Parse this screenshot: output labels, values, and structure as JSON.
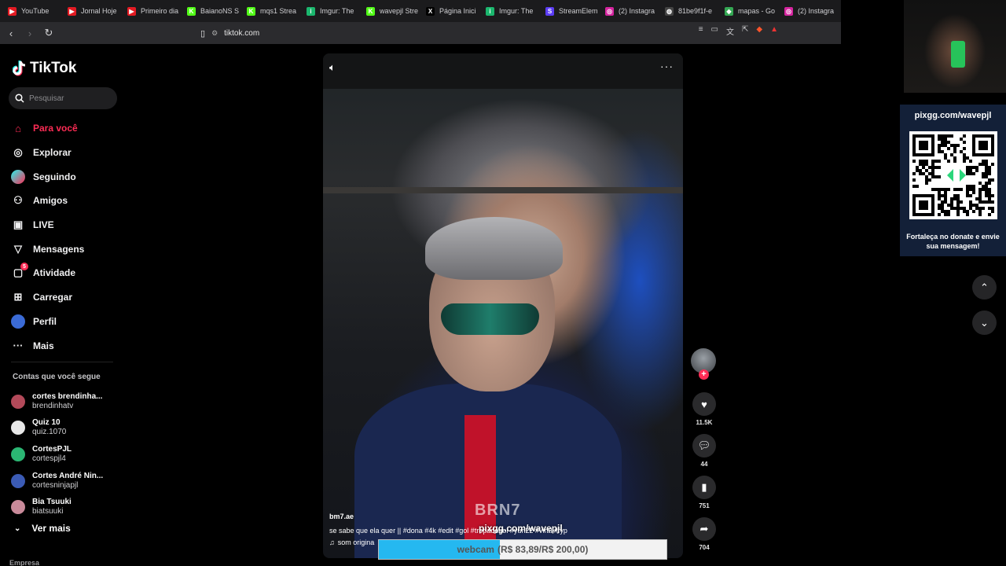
{
  "browser": {
    "tabs": [
      {
        "title": "YouTube",
        "color": "#e31b23",
        "glyph": "▶"
      },
      {
        "title": "Jornal Hoje",
        "color": "#e31b23",
        "glyph": "▶"
      },
      {
        "title": "Primeiro dia",
        "color": "#e31b23",
        "glyph": "▶"
      },
      {
        "title": "BaianoNS S",
        "color": "#53fc18",
        "glyph": "K"
      },
      {
        "title": "mqs1 Strea",
        "color": "#53fc18",
        "glyph": "K"
      },
      {
        "title": "Imgur: The",
        "color": "#1bb76e",
        "glyph": "i"
      },
      {
        "title": "wavepjl Stre",
        "color": "#53fc18",
        "glyph": "K"
      },
      {
        "title": "Página Inici",
        "color": "#000000",
        "glyph": "X"
      },
      {
        "title": "Imgur: The",
        "color": "#1bb76e",
        "glyph": "i"
      },
      {
        "title": "StreamElem",
        "color": "#5b3df5",
        "glyph": "S"
      },
      {
        "title": "(2) Instagra",
        "color": "#d6249f",
        "glyph": "◎"
      },
      {
        "title": "81be9f1f-e",
        "color": "#444444",
        "glyph": "◍"
      },
      {
        "title": "mapas - Go",
        "color": "#34a853",
        "glyph": "◆"
      },
      {
        "title": "(2) Instagra",
        "color": "#d6249f",
        "glyph": "◎"
      }
    ],
    "url": "tiktok.com"
  },
  "sidebar": {
    "logo": "TikTok",
    "search_placeholder": "Pesquisar",
    "menu": [
      {
        "label": "Para você",
        "icon": "home-icon",
        "glyph": "⌂",
        "active": true
      },
      {
        "label": "Explorar",
        "icon": "compass-icon",
        "glyph": "◎"
      },
      {
        "label": "Seguindo",
        "icon": "following-icon",
        "glyph": "●"
      },
      {
        "label": "Amigos",
        "icon": "friends-icon",
        "glyph": "⚇"
      },
      {
        "label": "LIVE",
        "icon": "live-icon",
        "glyph": "▣"
      },
      {
        "label": "Mensagens",
        "icon": "messages-icon",
        "glyph": "▽"
      },
      {
        "label": "Atividade",
        "icon": "activity-icon",
        "glyph": "▢",
        "badge": "5"
      },
      {
        "label": "Carregar",
        "icon": "upload-icon",
        "glyph": "⊞"
      },
      {
        "label": "Perfil",
        "icon": "profile-avatar-icon",
        "glyph": "●"
      },
      {
        "label": "Mais",
        "icon": "more-icon",
        "glyph": "···"
      }
    ],
    "following_title": "Contas que você segue",
    "following": [
      {
        "name": "cortes brendinha...",
        "user": "brendinhatv",
        "color": "#b34a5a"
      },
      {
        "name": "Quiz 10",
        "user": "quiz.1070",
        "color": "#e8e8e8"
      },
      {
        "name": "CortesPJL",
        "user": "cortespjl4",
        "color": "#2bb673"
      },
      {
        "name": "Cortes André Nin...",
        "user": "cortesninjapjl",
        "color": "#3b5bb5"
      },
      {
        "name": "Bia Tsuuki",
        "user": "biatsuuki",
        "color": "#c98a9a"
      }
    ],
    "see_more": "Ver mais",
    "footer_label": "Empresa"
  },
  "video": {
    "author": "bm7.ae",
    "caption": "se sabe que ela quer || #dona #4k #edit #gol #tropadogol #yuri22 #viral #fyp",
    "sound": "som origina",
    "overlay_watermark": "BRN7",
    "overlay_url": "pixgg.com/wavepjl"
  },
  "goal": {
    "label": "webcam",
    "amount": "(R$ 83,89/R$ 200,00)",
    "progress": 0.42,
    "fill_color": "#25b8f0"
  },
  "actions": {
    "likes": "11.5K",
    "comments": "44",
    "saves": "751",
    "shares": "704"
  },
  "donation_widget": {
    "url": "pixgg.com/wavepjl",
    "message": "Fortaleça no donate e envie sua mensagem!"
  },
  "colors": {
    "accent": "#fe2c55",
    "background": "#000000"
  }
}
